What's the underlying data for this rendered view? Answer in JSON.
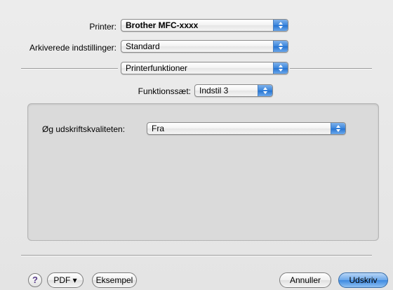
{
  "printer": {
    "label": "Printer:",
    "value": "Brother MFC-xxxx"
  },
  "presets": {
    "label": "Arkiverede indstillinger:",
    "value": "Standard"
  },
  "pane": {
    "value": "Printerfunktioner"
  },
  "feature_set": {
    "label": "Funktionssæt:",
    "value": "Indstil 3"
  },
  "quality": {
    "label": "Øg udskriftskvaliteten:",
    "value": "Fra"
  },
  "footer": {
    "help_label": "?",
    "pdf_label": "PDF ▾",
    "preview_label": "Eksempel",
    "cancel_label": "Annuller",
    "print_label": "Udskriv"
  },
  "colors": {
    "accent": "#3d89e0"
  }
}
